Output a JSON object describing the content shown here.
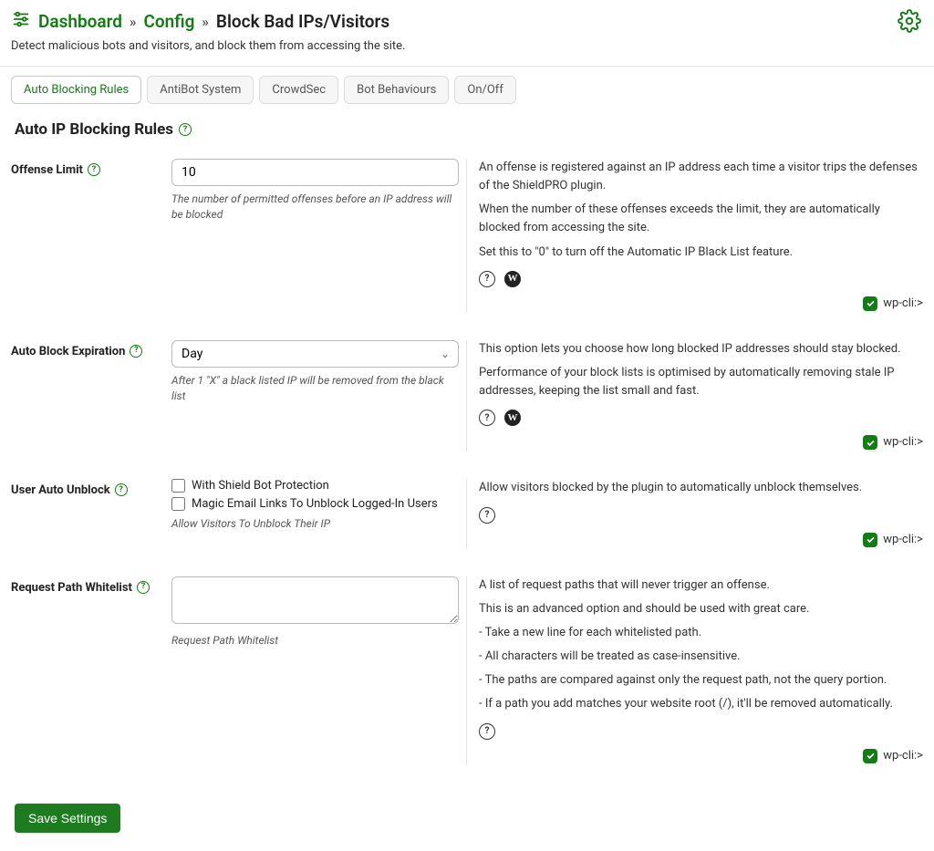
{
  "breadcrumb": {
    "dashboard": "Dashboard",
    "config": "Config",
    "current": "Block Bad IPs/Visitors"
  },
  "subtitle": "Detect malicious bots and visitors, and block them from accessing the site.",
  "tabs": [
    {
      "label": "Auto Blocking Rules",
      "active": true
    },
    {
      "label": "AntiBot System"
    },
    {
      "label": "CrowdSec"
    },
    {
      "label": "Bot Behaviours"
    },
    {
      "label": "On/Off"
    }
  ],
  "panel_title": "Auto IP Blocking Rules",
  "wp_cli_label": "wp-cli:>",
  "fields": {
    "offense_limit": {
      "label": "Offense Limit",
      "value": "10",
      "help": "The number of permitted offenses before an IP address will be blocked",
      "desc1": "An offense is registered against an IP address each time a visitor trips the defenses of the ShieldPRO plugin.",
      "desc2": "When the number of these offenses exceeds the limit, they are automatically blocked from accessing the site.",
      "desc3": "Set this to \"0\" to turn off the Automatic IP Black List feature."
    },
    "auto_block_expiration": {
      "label": "Auto Block Expiration",
      "value": "Day",
      "help": "After 1 \"X\" a black listed IP will be removed from the black list",
      "desc1": "This option lets you choose how long blocked IP addresses should stay blocked.",
      "desc2": "Performance of your block lists is optimised by automatically removing stale IP addresses, keeping the list small and fast."
    },
    "user_auto_unblock": {
      "label": "User Auto Unblock",
      "opt1": "With Shield Bot Protection",
      "opt2": "Magic Email Links To Unblock Logged-In Users",
      "help": "Allow Visitors To Unblock Their IP",
      "desc1": "Allow visitors blocked by the plugin to automatically unblock themselves."
    },
    "request_path_whitelist": {
      "label": "Request Path Whitelist",
      "help": "Request Path Whitelist",
      "desc1": "A list of request paths that will never trigger an offense.",
      "desc2": "This is an advanced option and should be used with great care.",
      "desc3": "- Take a new line for each whitelisted path.",
      "desc4": "- All characters will be treated as case-insensitive.",
      "desc5": "- The paths are compared against only the request path, not the query portion.",
      "desc6": "- If a path you add matches your website root (/), it'll be removed automatically."
    }
  },
  "save_button": "Save Settings"
}
